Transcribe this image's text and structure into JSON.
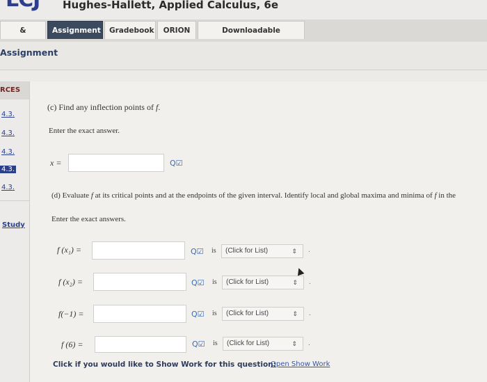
{
  "header": {
    "logo_partial": "LCJ",
    "book_title": "Hughes-Hallett, Applied Calculus, 6e"
  },
  "tabs": [
    {
      "label": "& Practice"
    },
    {
      "label": "Assignment"
    },
    {
      "label": "Gradebook"
    },
    {
      "label": "ORION"
    },
    {
      "label": "Downloadable eTextbook"
    }
  ],
  "section_title": "Assignment",
  "sidebar": {
    "heading": "RCES",
    "links": [
      "4.3.",
      "4.3.",
      "4.3.",
      "4.3.",
      "4.3."
    ],
    "study_label": "Study"
  },
  "part_c": {
    "prompt_prefix": "(c) Find any inflection points of ",
    "prompt_var": "f",
    "prompt_suffix": ".",
    "instruction": "Enter the exact answer.",
    "answer_label": "x =",
    "answer_value": ""
  },
  "part_d": {
    "prompt_prefix": "(d) Evaluate ",
    "prompt_var": "f",
    "prompt_mid": " at its critical points and at the endpoints of the given interval. Identify local and global maxima and minima of ",
    "prompt_var2": "f",
    "prompt_suffix": " in the",
    "instruction": "Enter the exact answers.",
    "rows": [
      {
        "label": "f (x₁) =",
        "value": "",
        "is": "is",
        "select": "(Click for List)"
      },
      {
        "label": "f (x₂) =",
        "value": "",
        "is": "is",
        "select": "(Click for List)"
      },
      {
        "label": "f(−1) =",
        "value": "",
        "is": "is",
        "select": "(Click for List)"
      },
      {
        "label": "f (6) =",
        "value": "",
        "is": "is",
        "select": "(Click for List)"
      }
    ]
  },
  "tools_glyph": "Q☑",
  "show_work": {
    "prompt": "Click if you would like to Show Work for this question:",
    "link": "Open Show Work"
  },
  "colors": {
    "active_tab": "#3b4a5f",
    "link": "#2b3f88",
    "tool_icon": "#3a6ab0"
  }
}
